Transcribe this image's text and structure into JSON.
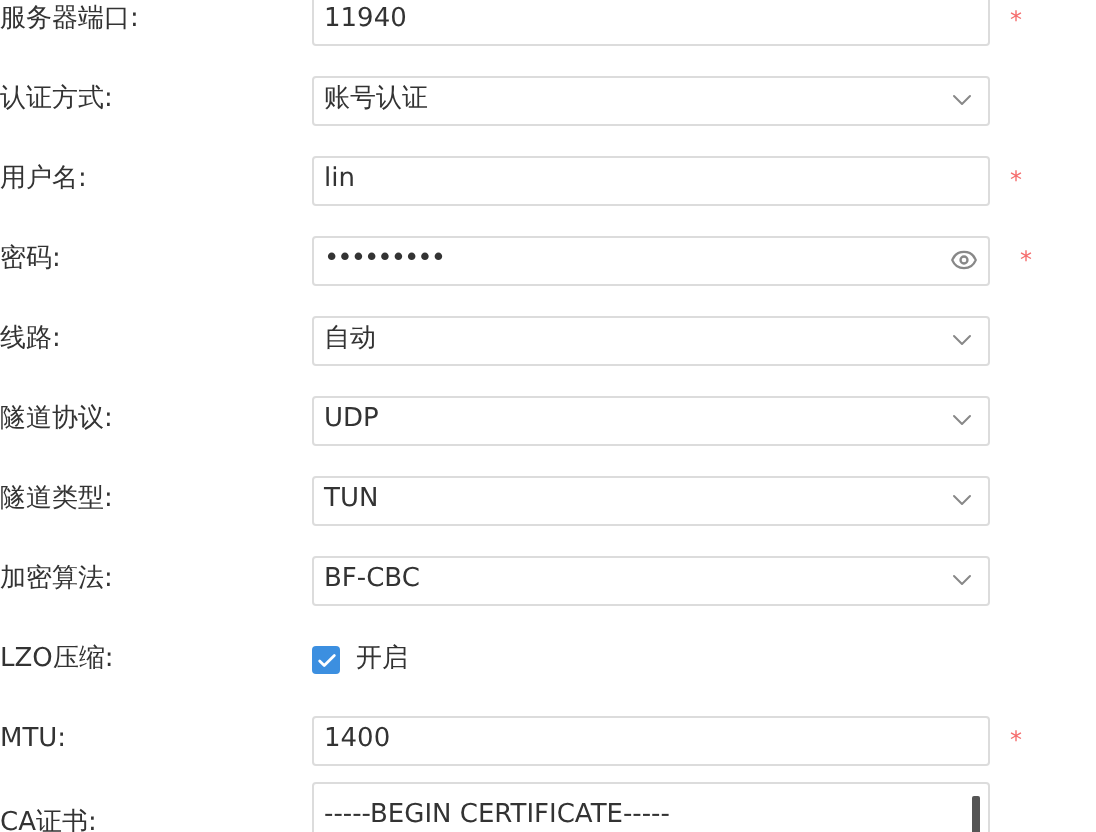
{
  "fields": [
    {
      "kind": "text",
      "label": "服务器端口:",
      "value": "11940",
      "required_mark": "*"
    },
    {
      "kind": "select",
      "label": "认证方式:",
      "value": "账号认证"
    },
    {
      "kind": "text",
      "label": "用户名:",
      "value": "lin",
      "required_mark": "*"
    },
    {
      "kind": "password",
      "label": "密码:",
      "value": "•••••••••",
      "required_mark": "*"
    },
    {
      "kind": "select",
      "label": "线路:",
      "value": "自动"
    },
    {
      "kind": "select",
      "label": "隧道协议:",
      "value": "UDP"
    },
    {
      "kind": "select",
      "label": "隧道类型:",
      "value": "TUN"
    },
    {
      "kind": "select",
      "label": "加密算法:",
      "value": "BF-CBC"
    },
    {
      "kind": "checkbox",
      "label": "LZO压缩:",
      "value": "开启",
      "checked": true
    },
    {
      "kind": "text",
      "label": "MTU:",
      "value": "1400",
      "required_mark": "*"
    },
    {
      "kind": "textarea",
      "label": "CA证书:",
      "value": "-----BEGIN CERTIFICATE-----"
    }
  ]
}
